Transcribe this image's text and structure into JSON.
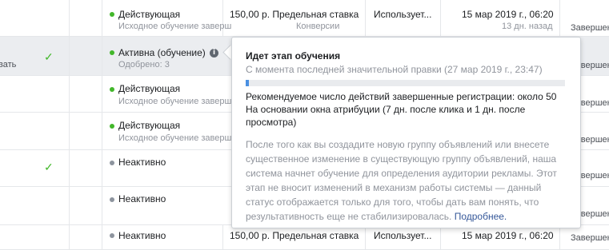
{
  "rows": [
    {
      "status": "Действующая",
      "status_sub": "Исходное обучение заверш",
      "dot": "green",
      "budget": "150,00 р. Предельная ставка",
      "budget_sub": "Конверсии",
      "uses": "Использует...",
      "date": "15 мар 2019 г., 06:20",
      "date_sub": "13 дн. назад",
      "right": "Завершен"
    },
    {
      "left": "вать",
      "status": "Активна (обучение)",
      "status_sub": "Одобрено: 3",
      "dot": "green",
      "right": "Завершен"
    },
    {
      "status": "Действующая",
      "status_sub": "Исходное обучение заверш",
      "dot": "green",
      "right": "Завершен"
    },
    {
      "status": "Действующая",
      "status_sub": "Исходное обучение заверш",
      "dot": "green",
      "right": "Завершен"
    },
    {
      "status": "Неактивно",
      "dot": "gray",
      "right": "Завершен"
    },
    {
      "status": "Неактивно",
      "dot": "gray",
      "right": "Завершен"
    },
    {
      "status": "Неактивно",
      "dot": "gray",
      "budget": "150,00 р. Предельная ставка",
      "uses": "Использует...",
      "date": "15 мар 2019 г., 06:20",
      "right": "Завершен"
    }
  ],
  "checkmark": "✓",
  "info_icon_glyph": "i",
  "tooltip": {
    "title": "Идет этап обучения",
    "subtitle": "С момента последней значительной правки (27 мар 2019 г., 23:47)",
    "progress_percent": 1,
    "line1": "Рекомендуемое число действий завершенные регистрации: около 50",
    "line2": "На основании окна атрибуции (7 дн. после клика и 1 дн. после",
    "line3": "просмотра)",
    "body": "После того как вы создадите новую группу объявлений или внесете существенное изменение в существующую группу объявлений, наша система начнет обучение для определения аудитории рекламы. Этот этап не вносит изменений в механизм работы системы — данный статус отображается только для того, чтобы дать вам понять, что результативность еще не стабилизировалась.",
    "link": "Подробнее."
  },
  "colors": {
    "accent": "#4a90e2",
    "active_dot": "#42b72a",
    "inactive_dot": "#8d949e",
    "link": "#365899"
  }
}
